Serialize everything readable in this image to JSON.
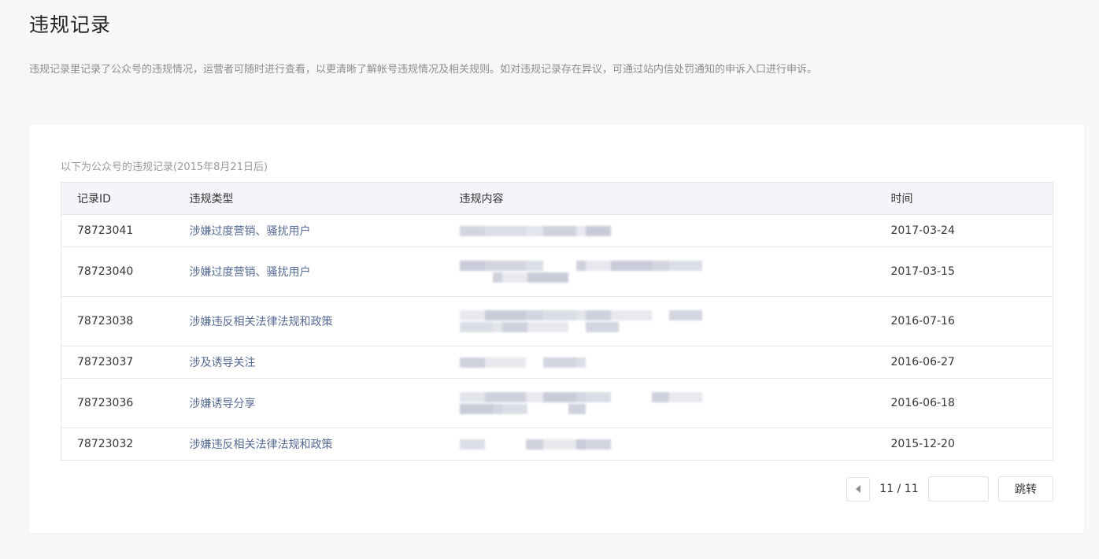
{
  "page": {
    "title": "违规记录",
    "description": "违规记录里记录了公众号的违规情况，运营者可随时进行查看，以更清晰了解帐号违规情况及相关规则。如对违规记录存在异议，可通过站内信处罚通知的申诉入口进行申诉。"
  },
  "table": {
    "caption": "以下为公众号的违规记录(2015年8月21日后)",
    "headers": [
      "记录ID",
      "违规类型",
      "违规内容",
      "时间"
    ],
    "rows": [
      {
        "id": "78723041",
        "type": "涉嫌过度营销、骚扰用户",
        "time": "2017-03-24",
        "content_lines": 1
      },
      {
        "id": "78723040",
        "type": "涉嫌过度营销、骚扰用户",
        "time": "2017-03-15",
        "content_lines": 2
      },
      {
        "id": "78723038",
        "type": "涉嫌违反相关法律法规和政策",
        "time": "2016-07-16",
        "content_lines": 2
      },
      {
        "id": "78723037",
        "type": "涉及诱导关注",
        "time": "2016-06-27",
        "content_lines": 1
      },
      {
        "id": "78723036",
        "type": "涉嫌诱导分享",
        "time": "2016-06-18",
        "content_lines": 2
      },
      {
        "id": "78723032",
        "type": "涉嫌违反相关法律法规和政策",
        "time": "2015-12-20",
        "content_lines": 1
      }
    ]
  },
  "pagination": {
    "current": "11 / 11",
    "jump_input_value": "",
    "jump_label": "跳转",
    "prev_icon": "triangle-left-icon"
  },
  "colors": {
    "background": "#f6f7f9",
    "card": "#ffffff",
    "link": "#576b95",
    "header_row": "#f4f5f9",
    "pixelation": "#d6d8e3"
  }
}
